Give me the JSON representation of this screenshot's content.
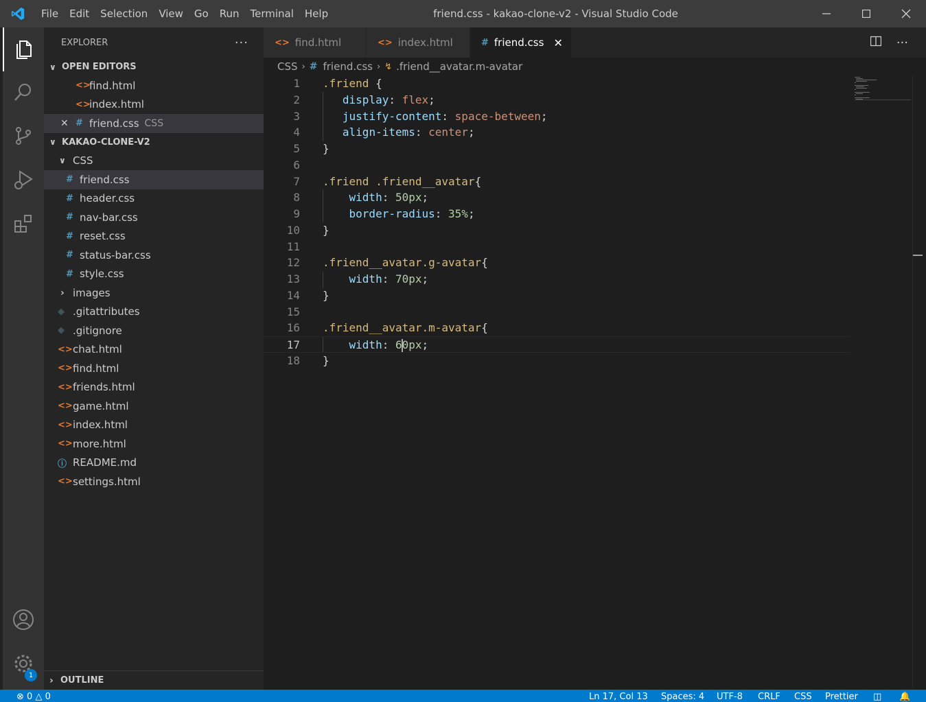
{
  "window": {
    "title": "friend.css - kakao-clone-v2 - Visual Studio Code",
    "menu": [
      "File",
      "Edit",
      "Selection",
      "View",
      "Go",
      "Run",
      "Terminal",
      "Help"
    ]
  },
  "sidebar": {
    "title": "EXPLORER",
    "open_editors": {
      "label": "OPEN EDITORS",
      "items": [
        {
          "name": "find.html",
          "type": "html"
        },
        {
          "name": "index.html",
          "type": "html"
        },
        {
          "name": "friend.css",
          "type": "css",
          "folder": "CSS"
        }
      ]
    },
    "project": {
      "label": "KAKAO-CLONE-V2",
      "css_folder": "CSS",
      "css_files": [
        "friend.css",
        "header.css",
        "nav-bar.css",
        "reset.css",
        "status-bar.css",
        "style.css"
      ],
      "images_folder": "images",
      "files": [
        {
          "name": ".gitattributes",
          "type": "git"
        },
        {
          "name": ".gitignore",
          "type": "git"
        },
        {
          "name": "chat.html",
          "type": "html"
        },
        {
          "name": "find.html",
          "type": "html"
        },
        {
          "name": "friends.html",
          "type": "html"
        },
        {
          "name": "game.html",
          "type": "html"
        },
        {
          "name": "index.html",
          "type": "html"
        },
        {
          "name": "more.html",
          "type": "html"
        },
        {
          "name": "README.md",
          "type": "info"
        },
        {
          "name": "settings.html",
          "type": "html"
        }
      ]
    },
    "outline_label": "OUTLINE"
  },
  "tabs": [
    {
      "label": "find.html",
      "icon": "<>",
      "active": false
    },
    {
      "label": "index.html",
      "icon": "<>",
      "active": false
    },
    {
      "label": "friend.css",
      "icon": "#",
      "active": true
    }
  ],
  "breadcrumb": {
    "folder": "CSS",
    "file": "friend.css",
    "symbol": ".friend__avatar.m-avatar"
  },
  "code": {
    "lines": [
      [
        [
          "sel",
          ".friend"
        ],
        [
          "pun",
          " {"
        ]
      ],
      [
        [
          "sp",
          "   "
        ],
        [
          "prop",
          "display"
        ],
        [
          "pun",
          ": "
        ],
        [
          "val",
          "flex"
        ],
        [
          "pun",
          ";"
        ]
      ],
      [
        [
          "sp",
          "   "
        ],
        [
          "prop",
          "justify-content"
        ],
        [
          "pun",
          ": "
        ],
        [
          "val",
          "space-between"
        ],
        [
          "pun",
          ";"
        ]
      ],
      [
        [
          "sp",
          "   "
        ],
        [
          "prop",
          "align-items"
        ],
        [
          "pun",
          ": "
        ],
        [
          "val",
          "center"
        ],
        [
          "pun",
          ";"
        ]
      ],
      [
        [
          "pun",
          "}"
        ]
      ],
      [],
      [
        [
          "sel",
          ".friend .friend__avatar"
        ],
        [
          "pun",
          "{"
        ]
      ],
      [
        [
          "sp",
          "    "
        ],
        [
          "prop",
          "width"
        ],
        [
          "pun",
          ": "
        ],
        [
          "num",
          "50px"
        ],
        [
          "pun",
          ";"
        ]
      ],
      [
        [
          "sp",
          "    "
        ],
        [
          "prop",
          "border-radius"
        ],
        [
          "pun",
          ": "
        ],
        [
          "num",
          "35%"
        ],
        [
          "pun",
          ";"
        ]
      ],
      [
        [
          "pun",
          "}"
        ]
      ],
      [],
      [
        [
          "sel",
          ".friend__avatar.g-avatar"
        ],
        [
          "pun",
          "{"
        ]
      ],
      [
        [
          "sp",
          "    "
        ],
        [
          "prop",
          "width"
        ],
        [
          "pun",
          ": "
        ],
        [
          "num",
          "70px"
        ],
        [
          "pun",
          ";"
        ]
      ],
      [
        [
          "pun",
          "}"
        ]
      ],
      [],
      [
        [
          "sel",
          ".friend__avatar.m-avatar"
        ],
        [
          "pun",
          "{"
        ]
      ],
      [
        [
          "sp",
          "    "
        ],
        [
          "prop",
          "width"
        ],
        [
          "pun",
          ": "
        ],
        [
          "num",
          "6"
        ],
        [
          "cursor",
          ""
        ],
        [
          "num",
          "0px"
        ],
        [
          "pun",
          ";"
        ]
      ],
      [
        [
          "pun",
          "}"
        ]
      ]
    ],
    "current_line": 17
  },
  "status": {
    "errors": "0",
    "warnings": "0",
    "position": "Ln 17, Col 13",
    "spaces": "Spaces: 4",
    "encoding": "UTF-8",
    "eol": "CRLF",
    "language": "CSS",
    "formatter": "Prettier"
  },
  "activity_badge": "1",
  "colors": {
    "accent": "#007acc",
    "html_icon": "#e37933",
    "css_icon": "#519aba",
    "selector": "#d7ba7d",
    "property": "#9cdcfe",
    "string_value": "#ce9178",
    "number_value": "#b5cea8"
  }
}
